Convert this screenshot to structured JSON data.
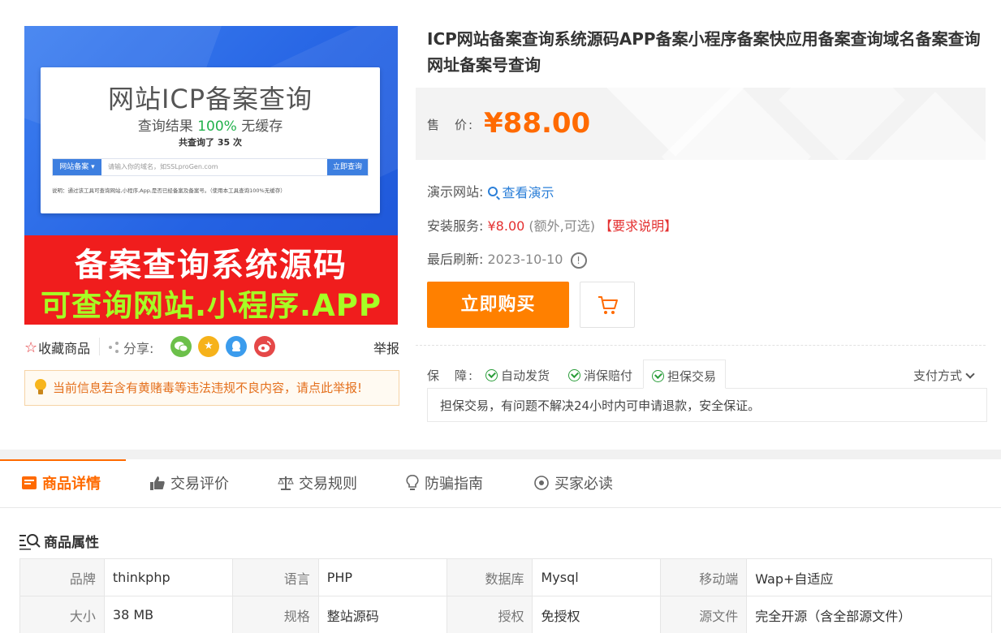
{
  "image": {
    "mock_title": "网站ICP备案查询",
    "mock_sub_a": "查询结果",
    "mock_sub_b": "100%",
    "mock_sub_c": "无缓存",
    "mock_count": "共查询了 35 次",
    "mock_select": "网站备案",
    "mock_placeholder": "请输入你的域名，如SSLproGen.com",
    "mock_button": "立即查询",
    "mock_note": "说明：通过该工具可查询网站,小程序,App,是否已经备案及备案号。（使用本工具查询100%无缓存）",
    "banner_line1": "备案查询系统源码",
    "banner_line2": "可查询网站.小程序.APP"
  },
  "left": {
    "favorite": "收藏商品",
    "share": "分享:",
    "report": "举报",
    "warning": "当前信息若含有黄赌毒等违法违规不良内容，请点此举报!"
  },
  "product": {
    "title": "ICP网站备案查询系统源码APP备案小程序备案快应用备案查询域名备案查询网址备案号查询",
    "price_label": "售　价:",
    "price": "¥88.00",
    "demo_label": "演示网站:",
    "demo_link": "查看演示",
    "install_label": "安装服务:",
    "install_price": "¥8.00",
    "install_note": "(额外,可选)",
    "install_req": "【要求说明】",
    "refresh_label": "最后刷新:",
    "refresh_date": "2023-10-10",
    "buy": "立即购买"
  },
  "guarantee": {
    "label": "保　障:",
    "tags": [
      "自动发货",
      "消保赔付",
      "担保交易"
    ],
    "pay_methods": "支付方式",
    "desc": "担保交易，有问题不解决24小时内可申请退款，安全保证。"
  },
  "tabs": [
    "商品详情",
    "交易评价",
    "交易规则",
    "防骗指南",
    "买家必读"
  ],
  "attributes": {
    "title": "商品属性",
    "rows": [
      [
        [
          "品牌",
          "thinkphp"
        ],
        [
          "语言",
          "PHP"
        ],
        [
          "数据库",
          "Mysql"
        ],
        [
          "移动端",
          "Wap+自适应"
        ]
      ],
      [
        [
          "大小",
          "38 MB"
        ],
        [
          "规格",
          "整站源码"
        ],
        [
          "授权",
          "免授权"
        ],
        [
          "源文件",
          "完全开源（含全部源文件）"
        ]
      ]
    ]
  },
  "colors": {
    "accent": "#ff6a00",
    "buy_button": "#ff8000",
    "link": "#2b7fd8",
    "red": "#e43030"
  }
}
